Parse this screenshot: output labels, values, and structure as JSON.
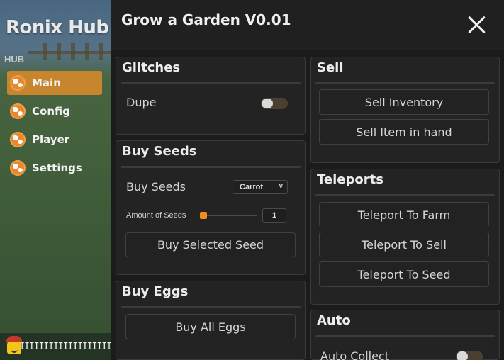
{
  "sidebar": {
    "title": "Ronix Hub",
    "section": "HUB",
    "items": [
      {
        "label": "Main",
        "icon": "globe-icon",
        "active": true
      },
      {
        "label": "Config",
        "icon": "globe-icon",
        "active": false
      },
      {
        "label": "Player",
        "icon": "globe-icon",
        "active": false
      },
      {
        "label": "Settings",
        "icon": "globe-icon",
        "active": false
      }
    ],
    "username": "IIIIIIIIIIIIIIIIIIII"
  },
  "window": {
    "title": "Grow a Garden V0.01",
    "close_icon": "close-icon"
  },
  "glitches": {
    "title": "Glitches",
    "dupe_label": "Dupe",
    "dupe_enabled": false
  },
  "buy_seeds": {
    "title": "Buy Seeds",
    "row_label": "Buy Seeds",
    "selected_seed": "Carrot",
    "amount_label": "Amount of Seeds",
    "amount_value": "1",
    "buy_button": "Buy Selected Seed"
  },
  "buy_eggs": {
    "title": "Buy Eggs",
    "buy_all_button": "Buy All Eggs"
  },
  "sell": {
    "title": "Sell",
    "inventory_button": "Sell Inventory",
    "hand_button": "Sell Item in hand"
  },
  "teleports": {
    "title": "Teleports",
    "buttons": [
      "Teleport To Farm",
      "Teleport To Sell",
      "Teleport To Seed"
    ]
  },
  "auto": {
    "title": "Auto",
    "collect_label": "Auto Collect",
    "collect_enabled": false
  },
  "colors": {
    "accent": "#c7852e",
    "slider": "#f08c1c",
    "panel": "#232323",
    "window": "#1b1b1b"
  }
}
